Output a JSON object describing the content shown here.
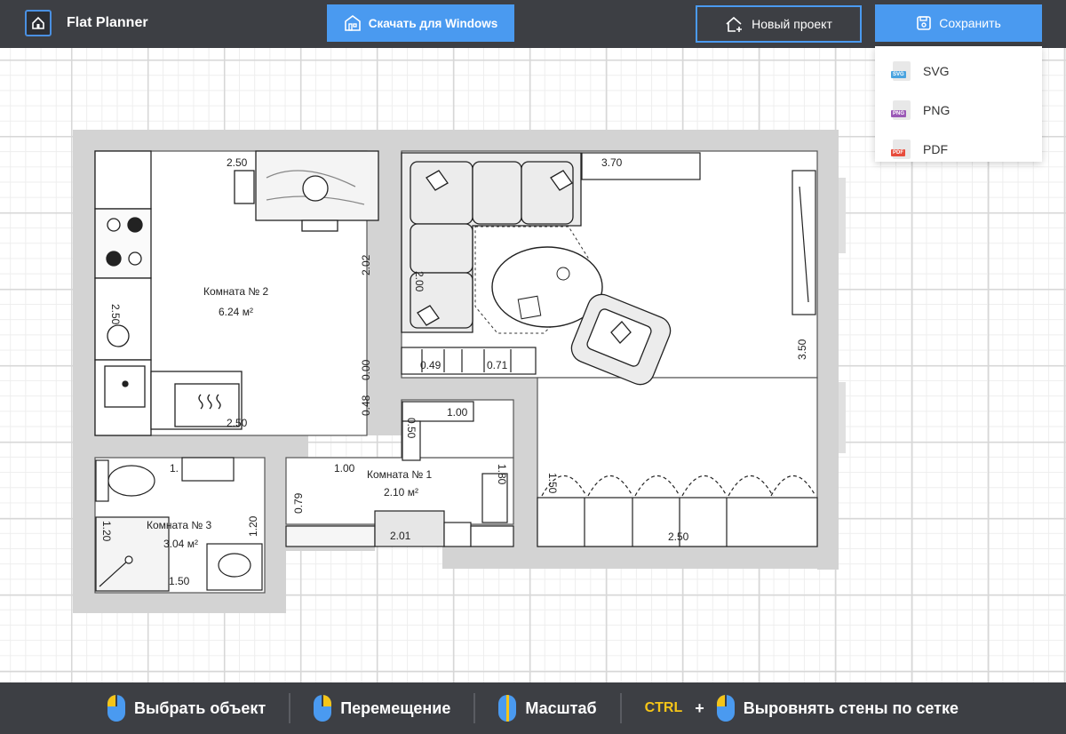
{
  "app": {
    "title": "Flat Planner"
  },
  "toolbar": {
    "download_label": "Скачать для Windows",
    "new_project_label": "Новый проект",
    "save_label": "Сохранить"
  },
  "save_menu": {
    "items": [
      {
        "label": "SVG",
        "icon": "svg-file-icon",
        "badge": "SVG",
        "color": "#4aa3df"
      },
      {
        "label": "PNG",
        "icon": "png-file-icon",
        "badge": "PNG",
        "color": "#9b59b6"
      },
      {
        "label": "PDF",
        "icon": "pdf-file-icon",
        "badge": "PDF",
        "color": "#e74c3c"
      }
    ]
  },
  "plan": {
    "rooms": [
      {
        "name": "Комната №  2",
        "area": "6.24 м²"
      },
      {
        "name": "Комната №  1",
        "area": "2.10 м²"
      },
      {
        "name": "Комната №  3",
        "area": "3.04 м²"
      }
    ],
    "dimensions": [
      "2.50",
      "2.02",
      "2.50",
      "0.00",
      "0.48",
      "2.50",
      "3.70",
      "2.00",
      "0.49",
      "0.71",
      "1.00",
      "0.50",
      "1.00",
      "1.80",
      "0.79",
      "2.01",
      "1.50",
      "3.50",
      "2.50",
      "1.20",
      "1.20",
      "1.50",
      "1."
    ]
  },
  "hints": {
    "select": "Выбрать объект",
    "move": "Перемещение",
    "scale": "Масштаб",
    "ctrl": "CTRL",
    "plus": "+",
    "align": "Выровнять стены по сетке"
  },
  "colors": {
    "topbar": "#3d3f44",
    "accent": "#4a9af0",
    "wall": "#d3d3d3",
    "mouse_highlight": "#f5c518"
  }
}
